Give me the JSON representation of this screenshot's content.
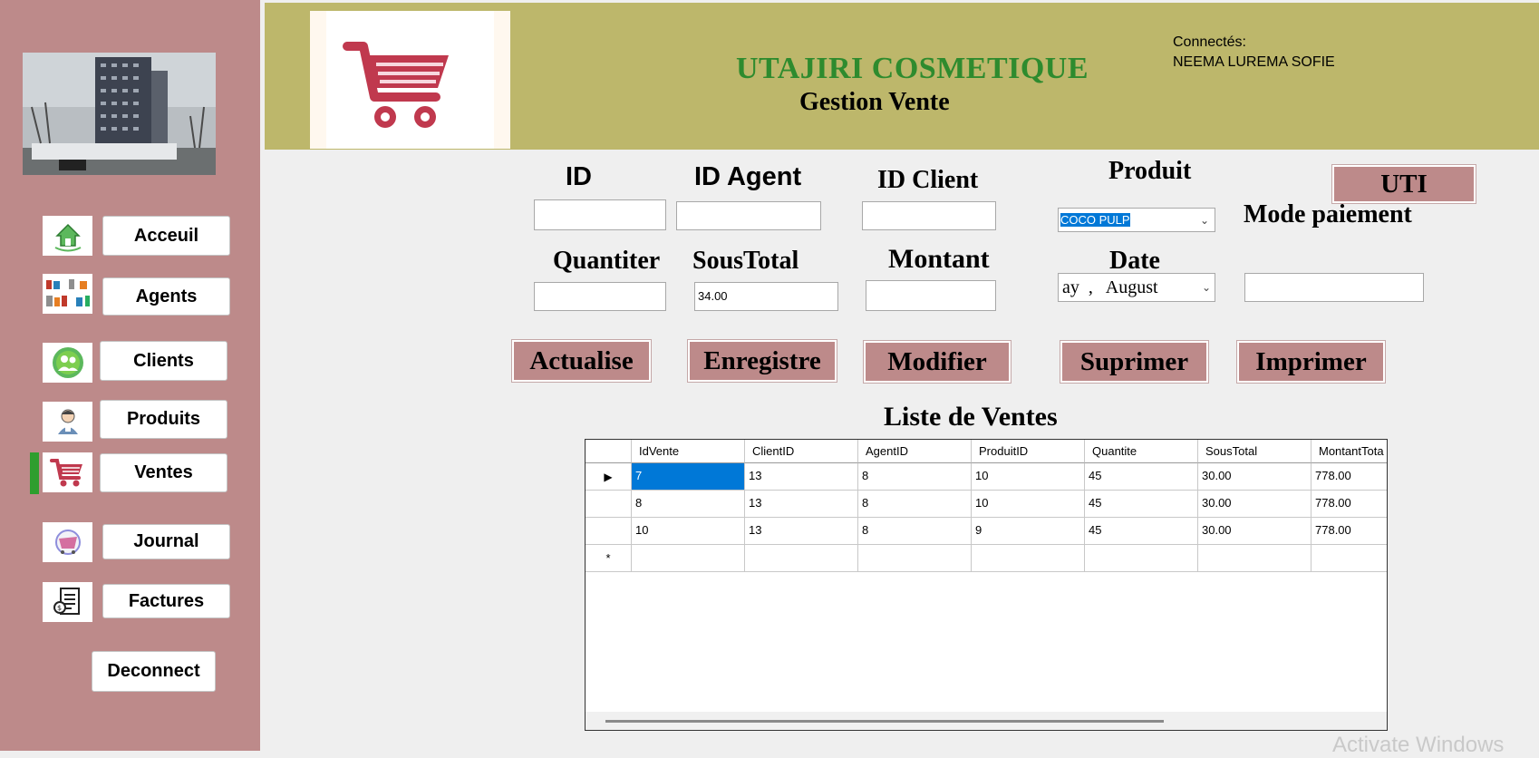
{
  "header": {
    "company": "UTAJIRI COSMETIQUE",
    "subtitle": "Gestion Vente",
    "connected_label": "Connectés:",
    "connected_user": "NEEMA LUREMA SOFIE"
  },
  "sidebar": {
    "items": [
      {
        "label": "Acceuil",
        "icon": "home-icon"
      },
      {
        "label": "Agents",
        "icon": "agents-icon"
      },
      {
        "label": "Clients",
        "icon": "clients-icon"
      },
      {
        "label": "Produits",
        "icon": "products-icon"
      },
      {
        "label": "Ventes",
        "icon": "cart-icon"
      },
      {
        "label": "Journal",
        "icon": "journal-icon"
      },
      {
        "label": "Factures",
        "icon": "invoice-icon"
      }
    ],
    "deconnect": "Deconnect"
  },
  "form": {
    "id_label": "ID",
    "id_agent_label": "ID Agent",
    "id_client_label": "ID Client",
    "produit_label": "Produit",
    "produit_value": "COCO PULP",
    "uti_label": "UTI",
    "mode_paiement_label": "Mode paiement",
    "quantiter_label": "Quantiter",
    "soustotal_label": "SousTotal",
    "soustotal_value": "34.00",
    "montant_label": "Montant",
    "date_label": "Date",
    "date_value": "ay  ,   August"
  },
  "actions": {
    "actualise": "Actualise",
    "enregistre": "Enregistre",
    "modifier": "Modifier",
    "suprimer": "Suprimer",
    "imprimer": "Imprimer"
  },
  "list_title": "Liste de Ventes",
  "table": {
    "columns": [
      "IdVente",
      "ClientID",
      "AgentID",
      "ProduitID",
      "Quantite",
      "SousTotal",
      "MontantTota"
    ],
    "rows": [
      [
        "7",
        "13",
        "8",
        "10",
        "45",
        "30.00",
        "778.00"
      ],
      [
        "8",
        "13",
        "8",
        "10",
        "45",
        "30.00",
        "778.00"
      ],
      [
        "10",
        "13",
        "8",
        "9",
        "45",
        "30.00",
        "778.00"
      ]
    ]
  },
  "watermark": "Activate Windows",
  "colors": {
    "sidebar": "#bd8a8a",
    "header": "#bdb76b",
    "title_green": "#2e8b2e",
    "active_indicator": "#2e9e2e"
  }
}
